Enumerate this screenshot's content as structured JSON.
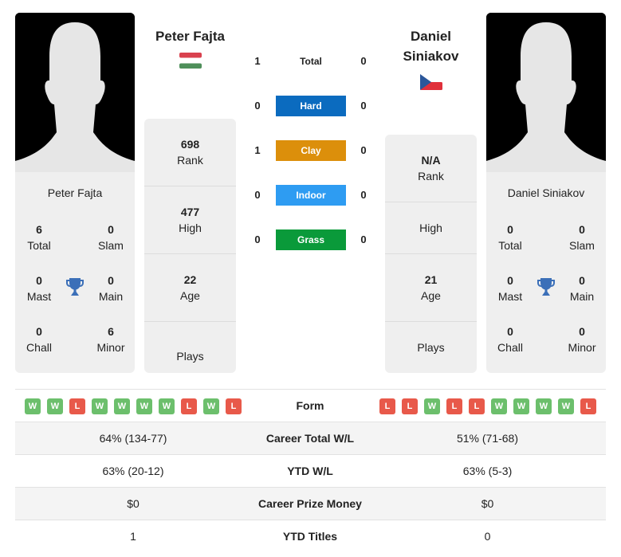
{
  "player1": {
    "name": "Peter Fajta",
    "card_name": "Peter Fajta",
    "flag": "hungary-flag",
    "titles": {
      "total": {
        "value": "6",
        "label": "Total"
      },
      "slam": {
        "value": "0",
        "label": "Slam"
      },
      "mast": {
        "value": "0",
        "label": "Mast"
      },
      "main": {
        "value": "0",
        "label": "Main"
      },
      "chall": {
        "value": "0",
        "label": "Chall"
      },
      "minor": {
        "value": "6",
        "label": "Minor"
      }
    },
    "info": {
      "rank": {
        "value": "698",
        "label": "Rank"
      },
      "high": {
        "value": "477",
        "label": "High"
      },
      "age": {
        "value": "22",
        "label": "Age"
      },
      "plays": {
        "value": "",
        "label": "Plays"
      }
    },
    "form": [
      "W",
      "W",
      "L",
      "W",
      "W",
      "W",
      "W",
      "L",
      "W",
      "L"
    ],
    "career_wl": "64% (134-77)",
    "ytd_wl": "63% (20-12)",
    "prize": "$0",
    "ytd_titles": "1"
  },
  "player2": {
    "name": "Daniel Siniakov",
    "name_line1": "Daniel",
    "name_line2": "Siniakov",
    "card_name": "Daniel Siniakov",
    "flag": "czech-flag",
    "titles": {
      "total": {
        "value": "0",
        "label": "Total"
      },
      "slam": {
        "value": "0",
        "label": "Slam"
      },
      "mast": {
        "value": "0",
        "label": "Mast"
      },
      "main": {
        "value": "0",
        "label": "Main"
      },
      "chall": {
        "value": "0",
        "label": "Chall"
      },
      "minor": {
        "value": "0",
        "label": "Minor"
      }
    },
    "info": {
      "rank": {
        "value": "N/A",
        "label": "Rank"
      },
      "high": {
        "value": "",
        "label": "High"
      },
      "age": {
        "value": "21",
        "label": "Age"
      },
      "plays": {
        "value": "",
        "label": "Plays"
      }
    },
    "form": [
      "L",
      "L",
      "W",
      "L",
      "L",
      "W",
      "W",
      "W",
      "W",
      "L"
    ],
    "career_wl": "51% (71-68)",
    "ytd_wl": "63% (5-3)",
    "prize": "$0",
    "ytd_titles": "0"
  },
  "h2h": [
    {
      "label": "Total",
      "p1": "1",
      "p2": "0",
      "color": ""
    },
    {
      "label": "Hard",
      "p1": "0",
      "p2": "0",
      "color": "#0b6bbf"
    },
    {
      "label": "Clay",
      "p1": "1",
      "p2": "0",
      "color": "#dc8f0b"
    },
    {
      "label": "Indoor",
      "p1": "0",
      "p2": "0",
      "color": "#2e9cf2"
    },
    {
      "label": "Grass",
      "p1": "0",
      "p2": "0",
      "color": "#0a9a3a"
    }
  ],
  "table": {
    "form_label": "Form",
    "career_label": "Career Total W/L",
    "ytd_label": "YTD W/L",
    "prize_label": "Career Prize Money",
    "titles_label": "YTD Titles"
  },
  "colors": {
    "win": "#6cbf6c",
    "loss": "#e8594a",
    "trophy": "#3b6fb8"
  }
}
